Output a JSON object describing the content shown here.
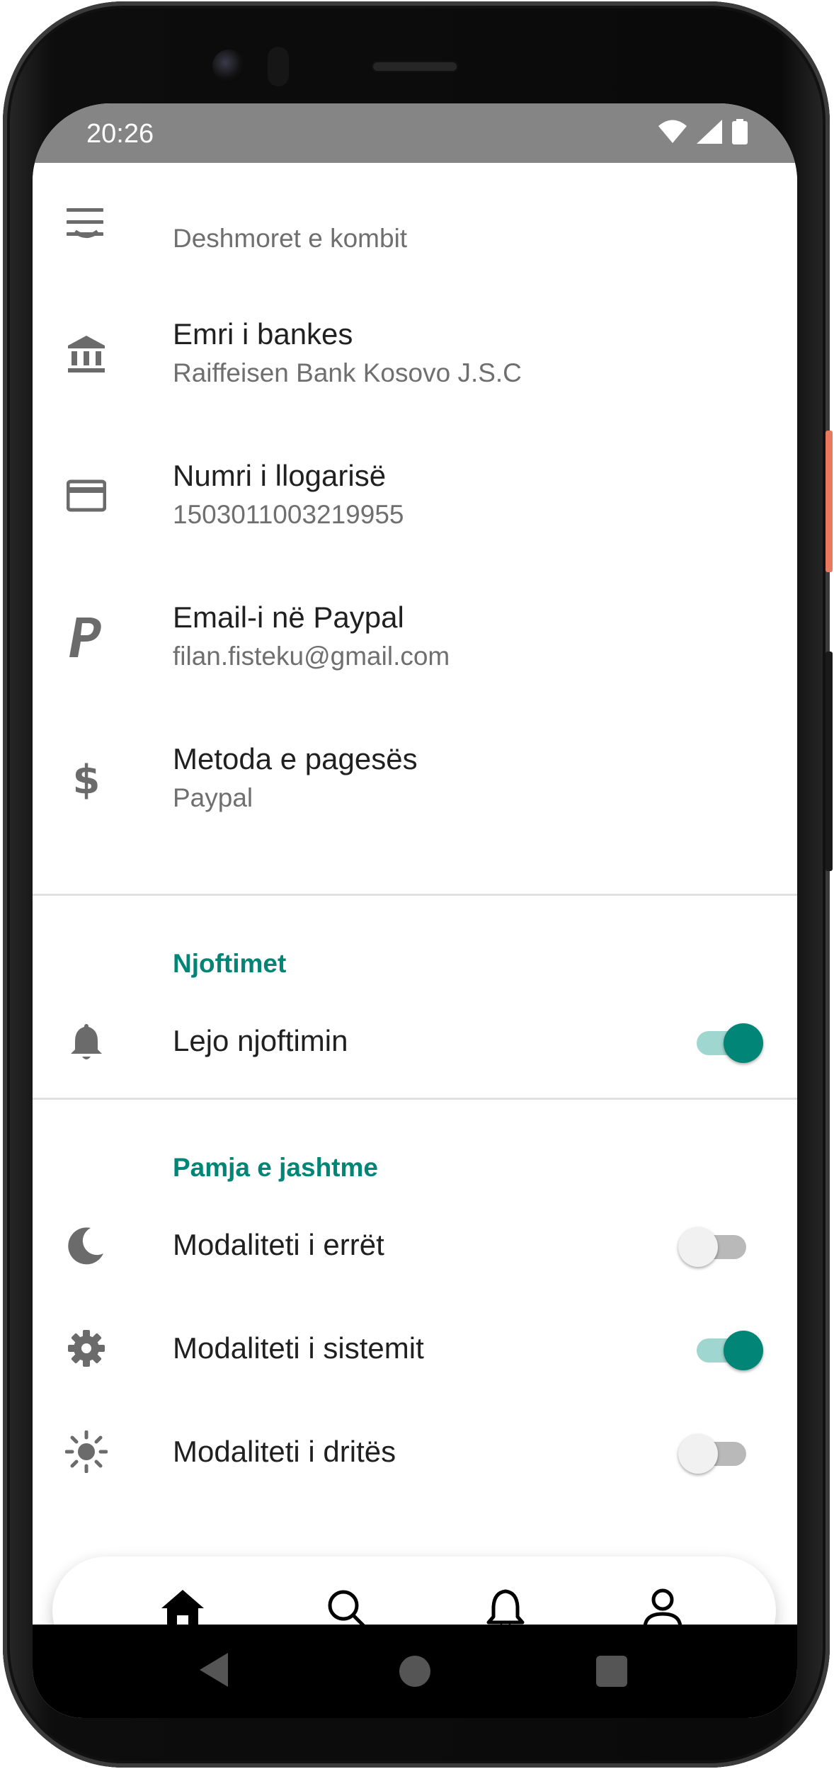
{
  "status_bar": {
    "time": "20:26"
  },
  "app": {
    "partial_row": {
      "subtitle": "Deshmoret e kombit"
    },
    "payment_rows": [
      {
        "icon": "bank-icon",
        "title": "Emri i bankes",
        "subtitle": "Raiffeisen Bank Kosovo J.S.C"
      },
      {
        "icon": "credit-card-icon",
        "title": "Numri i llogarisë",
        "subtitle": "1503011003219955"
      },
      {
        "icon": "paypal-icon",
        "title": "Email-i në Paypal",
        "subtitle": "filan.fisteku@gmail.com"
      },
      {
        "icon": "dollar-icon",
        "title": "Metoda e pagesës",
        "subtitle": "Paypal"
      }
    ],
    "notifications": {
      "header": "Njoftimet",
      "items": [
        {
          "icon": "bell-icon",
          "label": "Lejo njoftimin",
          "enabled": true
        }
      ]
    },
    "appearance": {
      "header": "Pamja e jashtme",
      "items": [
        {
          "icon": "moon-icon",
          "label": "Modaliteti i errët",
          "enabled": false
        },
        {
          "icon": "gear-icon",
          "label": "Modaliteti i sistemit",
          "enabled": true
        },
        {
          "icon": "sun-icon",
          "label": "Modaliteti i dritës",
          "enabled": false
        }
      ]
    },
    "bottom_nav": [
      {
        "icon": "home-icon",
        "active": true
      },
      {
        "icon": "search-icon",
        "active": false
      },
      {
        "icon": "bell-outline-icon",
        "active": false
      },
      {
        "icon": "person-icon",
        "active": false
      }
    ]
  },
  "colors": {
    "accent": "#008577",
    "accent_track": "#9fd6cf",
    "status_bar": "#858585",
    "text_primary": "#202020",
    "text_secondary": "#6f6f6f",
    "icon": "#6b6b6b"
  }
}
